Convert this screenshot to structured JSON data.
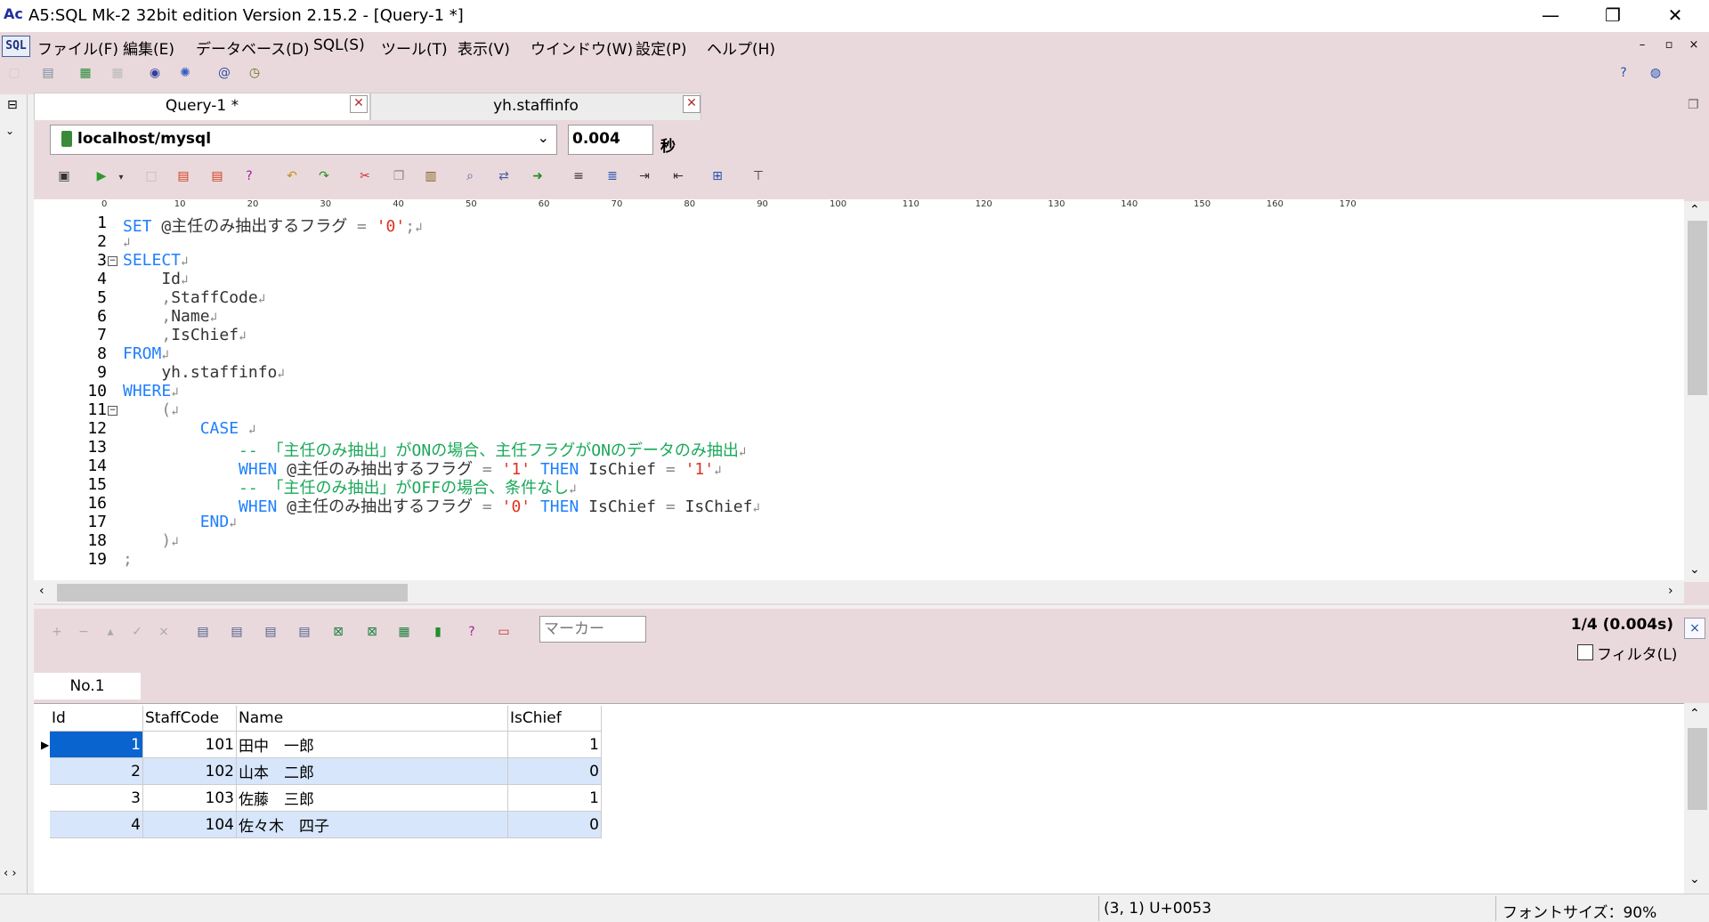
{
  "window": {
    "title": "A5:SQL Mk-2 32bit edition Version 2.15.2 - [Query-1 *]",
    "icon_label": "Ac",
    "minimize": "—",
    "maximize": "❐",
    "close": "✕"
  },
  "menu": {
    "icon_label": "SQL",
    "items": [
      "ファイル(F)",
      "編集(E)",
      "データベース(D)",
      "SQL(S)",
      "ツール(T)",
      "表示(V)",
      "ウインドウ(W)",
      "設定(P)",
      "ヘルプ(H)"
    ],
    "mdi": [
      "–",
      "▫",
      "×"
    ]
  },
  "tabs": [
    {
      "label": "Query-1 *"
    },
    {
      "label": "yh.staffinfo"
    }
  ],
  "connection": {
    "value": "localhost/mysql"
  },
  "exec_time": {
    "value": "0.004",
    "unit": "秒"
  },
  "ruler": {
    "ticks": [
      "0",
      "10",
      "20",
      "30",
      "40",
      "50",
      "60",
      "70",
      "80",
      "90",
      "100",
      "110",
      "120",
      "130",
      "140",
      "150",
      "160",
      "170"
    ]
  },
  "editor": {
    "line_numbers": [
      "1",
      "2",
      "3",
      "4",
      "5",
      "6",
      "7",
      "8",
      "9",
      "10",
      "11",
      "12",
      "13",
      "14",
      "15",
      "16",
      "17",
      "18",
      "19"
    ],
    "lines": [
      "SET @主任のみ抽出するフラグ = '0';",
      "",
      "SELECT",
      "    Id",
      "    ,StaffCode",
      "    ,Name",
      "    ,IsChief",
      "FROM",
      "    yh.staffinfo",
      "WHERE",
      "    (",
      "        CASE ",
      "            -- 「主任のみ抽出」がONの場合、主任フラグがONのデータのみ抽出",
      "            WHEN @主任のみ抽出するフラグ = '1' THEN IsChief = '1'",
      "            -- 「主任のみ抽出」がOFFの場合、条件なし",
      "            WHEN @主任のみ抽出するフラグ = '0' THEN IsChief = IsChief",
      "        END",
      "    )",
      ";"
    ]
  },
  "results": {
    "marker_placeholder": "マーカー",
    "count": "1/4 (0.004s)",
    "close": "×",
    "filter_label": "フィルタ(L)",
    "tab": "No.1",
    "columns": [
      "Id",
      "StaffCode",
      "Name",
      "IsChief"
    ],
    "rows": [
      [
        "1",
        "101",
        "田中　一郎",
        "1"
      ],
      [
        "2",
        "102",
        "山本　二郎",
        "0"
      ],
      [
        "3",
        "103",
        "佐藤　三郎",
        "1"
      ],
      [
        "4",
        "104",
        "佐々木　四子",
        "0"
      ]
    ]
  },
  "status": {
    "position": "(3, 1) U+0053",
    "font_size": "フォントサイズ：90%"
  }
}
